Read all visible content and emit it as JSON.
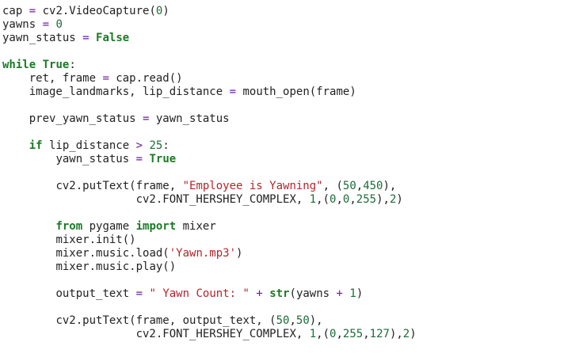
{
  "code": {
    "lines": [
      {
        "indent": "",
        "tokens": [
          {
            "t": "cap ",
            "k": "plain"
          },
          {
            "t": "=",
            "k": "op"
          },
          {
            "t": " cv2.VideoCapture(",
            "k": "plain"
          },
          {
            "t": "0",
            "k": "num"
          },
          {
            "t": ")",
            "k": "plain"
          }
        ]
      },
      {
        "indent": "",
        "tokens": [
          {
            "t": "yawns ",
            "k": "plain"
          },
          {
            "t": "=",
            "k": "op"
          },
          {
            "t": " ",
            "k": "plain"
          },
          {
            "t": "0",
            "k": "num"
          }
        ]
      },
      {
        "indent": "",
        "tokens": [
          {
            "t": "yawn_status ",
            "k": "plain"
          },
          {
            "t": "=",
            "k": "op"
          },
          {
            "t": " ",
            "k": "plain"
          },
          {
            "t": "False",
            "k": "kw"
          }
        ]
      },
      {
        "indent": "",
        "tokens": []
      },
      {
        "indent": "",
        "tokens": [
          {
            "t": "while",
            "k": "kw"
          },
          {
            "t": " ",
            "k": "plain"
          },
          {
            "t": "True",
            "k": "kw"
          },
          {
            "t": ":",
            "k": "plain"
          }
        ]
      },
      {
        "indent": "    ",
        "tokens": [
          {
            "t": "ret, frame ",
            "k": "plain"
          },
          {
            "t": "=",
            "k": "op"
          },
          {
            "t": " cap.read()",
            "k": "plain"
          }
        ]
      },
      {
        "indent": "    ",
        "tokens": [
          {
            "t": "image_landmarks, lip_distance ",
            "k": "plain"
          },
          {
            "t": "=",
            "k": "op"
          },
          {
            "t": " mouth_open(frame)",
            "k": "plain"
          }
        ]
      },
      {
        "indent": "",
        "tokens": []
      },
      {
        "indent": "    ",
        "tokens": [
          {
            "t": "prev_yawn_status ",
            "k": "plain"
          },
          {
            "t": "=",
            "k": "op"
          },
          {
            "t": " yawn_status",
            "k": "plain"
          }
        ]
      },
      {
        "indent": "",
        "tokens": []
      },
      {
        "indent": "    ",
        "tokens": [
          {
            "t": "if",
            "k": "kw"
          },
          {
            "t": " lip_distance ",
            "k": "plain"
          },
          {
            "t": ">",
            "k": "op"
          },
          {
            "t": " ",
            "k": "plain"
          },
          {
            "t": "25",
            "k": "num"
          },
          {
            "t": ":",
            "k": "plain"
          }
        ]
      },
      {
        "indent": "        ",
        "tokens": [
          {
            "t": "yawn_status ",
            "k": "plain"
          },
          {
            "t": "=",
            "k": "op"
          },
          {
            "t": " ",
            "k": "plain"
          },
          {
            "t": "True",
            "k": "kw"
          }
        ]
      },
      {
        "indent": "",
        "tokens": []
      },
      {
        "indent": "        ",
        "tokens": [
          {
            "t": "cv2.putText(frame, ",
            "k": "plain"
          },
          {
            "t": "\"Employee is Yawning\"",
            "k": "str"
          },
          {
            "t": ", (",
            "k": "plain"
          },
          {
            "t": "50",
            "k": "num"
          },
          {
            "t": ",",
            "k": "plain"
          },
          {
            "t": "450",
            "k": "num"
          },
          {
            "t": "),",
            "k": "plain"
          }
        ]
      },
      {
        "indent": "                    ",
        "tokens": [
          {
            "t": "cv2.FONT_HERSHEY_COMPLEX, ",
            "k": "plain"
          },
          {
            "t": "1",
            "k": "num"
          },
          {
            "t": ",(",
            "k": "plain"
          },
          {
            "t": "0",
            "k": "num"
          },
          {
            "t": ",",
            "k": "plain"
          },
          {
            "t": "0",
            "k": "num"
          },
          {
            "t": ",",
            "k": "plain"
          },
          {
            "t": "255",
            "k": "num"
          },
          {
            "t": "),",
            "k": "plain"
          },
          {
            "t": "2",
            "k": "num"
          },
          {
            "t": ")",
            "k": "plain"
          }
        ]
      },
      {
        "indent": "",
        "tokens": []
      },
      {
        "indent": "        ",
        "tokens": [
          {
            "t": "from",
            "k": "kw"
          },
          {
            "t": " pygame ",
            "k": "plain"
          },
          {
            "t": "import",
            "k": "kw"
          },
          {
            "t": " mixer",
            "k": "plain"
          }
        ]
      },
      {
        "indent": "        ",
        "tokens": [
          {
            "t": "mixer.init()",
            "k": "plain"
          }
        ]
      },
      {
        "indent": "        ",
        "tokens": [
          {
            "t": "mixer.music.load(",
            "k": "plain"
          },
          {
            "t": "'Yawn.mp3'",
            "k": "str"
          },
          {
            "t": ")",
            "k": "plain"
          }
        ]
      },
      {
        "indent": "        ",
        "tokens": [
          {
            "t": "mixer.music.play()",
            "k": "plain"
          }
        ]
      },
      {
        "indent": "",
        "tokens": []
      },
      {
        "indent": "        ",
        "tokens": [
          {
            "t": "output_text ",
            "k": "plain"
          },
          {
            "t": "=",
            "k": "op"
          },
          {
            "t": " ",
            "k": "plain"
          },
          {
            "t": "\" Yawn Count: \"",
            "k": "str"
          },
          {
            "t": " ",
            "k": "plain"
          },
          {
            "t": "+",
            "k": "op"
          },
          {
            "t": " ",
            "k": "plain"
          },
          {
            "t": "str",
            "k": "kw"
          },
          {
            "t": "(yawns ",
            "k": "plain"
          },
          {
            "t": "+",
            "k": "op"
          },
          {
            "t": " ",
            "k": "plain"
          },
          {
            "t": "1",
            "k": "num"
          },
          {
            "t": ")",
            "k": "plain"
          }
        ]
      },
      {
        "indent": "",
        "tokens": []
      },
      {
        "indent": "        ",
        "tokens": [
          {
            "t": "cv2.putText(frame, output_text, (",
            "k": "plain"
          },
          {
            "t": "50",
            "k": "num"
          },
          {
            "t": ",",
            "k": "plain"
          },
          {
            "t": "50",
            "k": "num"
          },
          {
            "t": "),",
            "k": "plain"
          }
        ]
      },
      {
        "indent": "                    ",
        "tokens": [
          {
            "t": "cv2.FONT_HERSHEY_COMPLEX, ",
            "k": "plain"
          },
          {
            "t": "1",
            "k": "num"
          },
          {
            "t": ",(",
            "k": "plain"
          },
          {
            "t": "0",
            "k": "num"
          },
          {
            "t": ",",
            "k": "plain"
          },
          {
            "t": "255",
            "k": "num"
          },
          {
            "t": ",",
            "k": "plain"
          },
          {
            "t": "127",
            "k": "num"
          },
          {
            "t": "),",
            "k": "plain"
          },
          {
            "t": "2",
            "k": "num"
          },
          {
            "t": ")",
            "k": "plain"
          }
        ]
      }
    ]
  }
}
